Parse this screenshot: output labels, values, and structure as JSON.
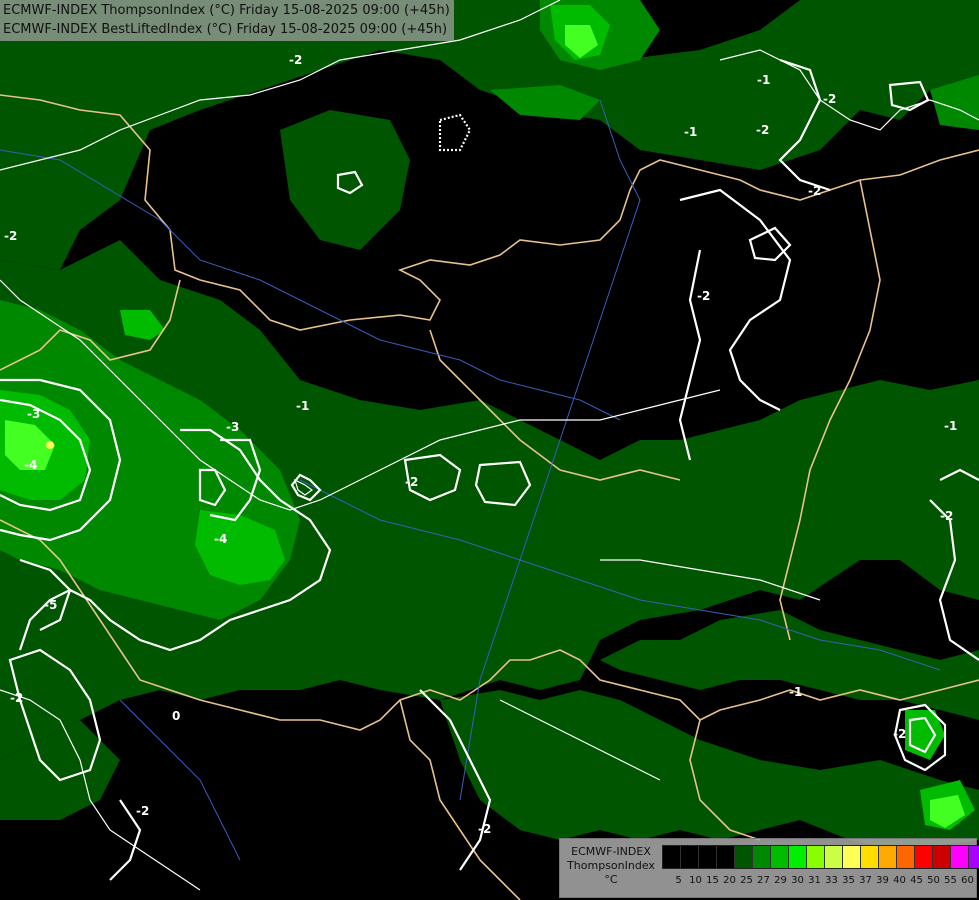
{
  "header": {
    "line1": "ECMWF-INDEX ThompsonIndex (°C) Friday 15-08-2025 09:00 (+45h)",
    "line2": "ECMWF-INDEX BestLiftedIndex (°C) Friday 15-08-2025 09:00 (+45h)"
  },
  "legend": {
    "model": "ECMWF-INDEX",
    "field": "ThompsonIndex",
    "unit": "°C",
    "ticks": [
      "5",
      "10",
      "15",
      "20",
      "25",
      "27",
      "29",
      "30",
      "31",
      "33",
      "35",
      "37",
      "39",
      "40",
      "45",
      "50",
      "55",
      "60"
    ],
    "colors": [
      "#000000",
      "#000000",
      "#000000",
      "#000000",
      "#005500",
      "#008800",
      "#00bb00",
      "#00ee00",
      "#88ff00",
      "#ccff44",
      "#ffff55",
      "#ffdd00",
      "#ffaa00",
      "#ff6600",
      "#ff0000",
      "#cc0000",
      "#ff00ff",
      "#aa00ff",
      "#6600ff",
      "#0000ff"
    ]
  },
  "contour_labels": [
    "-2",
    "-1",
    "-2",
    "-3",
    "-4",
    "-3",
    "-4",
    "-5",
    "-2",
    "-2",
    "-2",
    "-1",
    "-2",
    "-1",
    "-2",
    "-2",
    "-2",
    "0",
    "-2",
    "-1",
    "-2",
    "-1",
    "-2"
  ]
}
